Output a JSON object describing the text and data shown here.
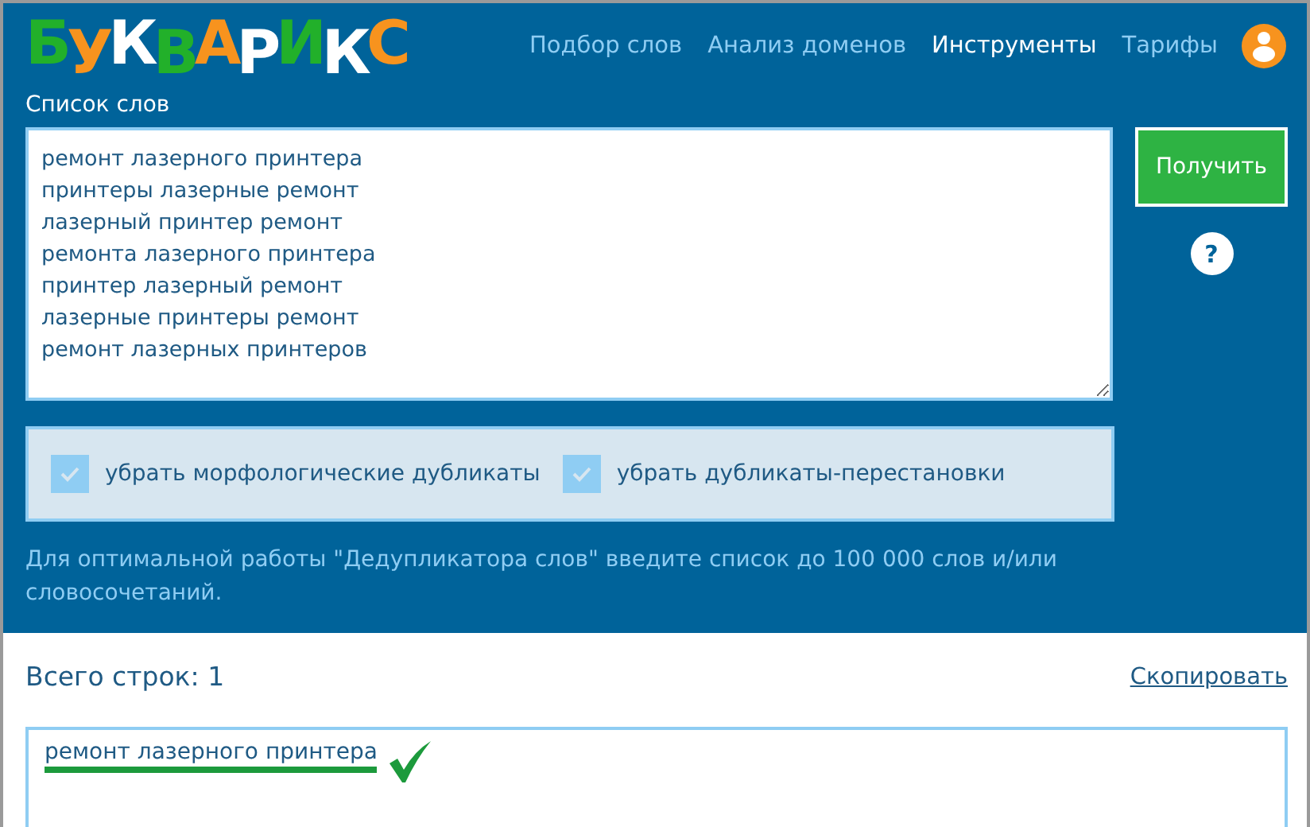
{
  "logo": {
    "letters": [
      {
        "char": "Б",
        "color": "#22b02a"
      },
      {
        "char": "У",
        "color": "#f7931e"
      },
      {
        "char": "К",
        "color": "#ffffff"
      },
      {
        "char": "В",
        "color": "#22b02a"
      },
      {
        "char": "А",
        "color": "#f7931e"
      },
      {
        "char": "Р",
        "color": "#ffffff"
      },
      {
        "char": "И",
        "color": "#22b02a"
      },
      {
        "char": "К",
        "color": "#ffffff"
      },
      {
        "char": "С",
        "color": "#f7931e"
      }
    ]
  },
  "nav": [
    {
      "label": "Подбор слов",
      "selected": false
    },
    {
      "label": "Анализ доменов",
      "selected": false
    },
    {
      "label": "Инструменты",
      "selected": true
    },
    {
      "label": "Тарифы",
      "selected": false
    }
  ],
  "word_list": {
    "label": "Список слов",
    "lines": [
      "ремонт лазерного принтера",
      "принтеры лазерные ремонт",
      "лазерный принтер ремонт",
      "ремонта лазерного принтера",
      "принтер лазерный ремонт",
      "лазерные принтеры ремонт",
      "ремонт лазерных принтеров"
    ]
  },
  "submit_button": "Получить",
  "help": "?",
  "options": [
    {
      "label": "убрать морфологические дубликаты",
      "checked": true
    },
    {
      "label": "убрать дубликаты-перестановки",
      "checked": true
    }
  ],
  "hint": "Для оптимальной работы \"Дедупликатора слов\" введите список до 100 000 слов и/или словосочетаний.",
  "result": {
    "count": "Всего строк: 1",
    "copy_link": "Скопировать",
    "rows": [
      "ремонт лазерного принтера"
    ]
  }
}
